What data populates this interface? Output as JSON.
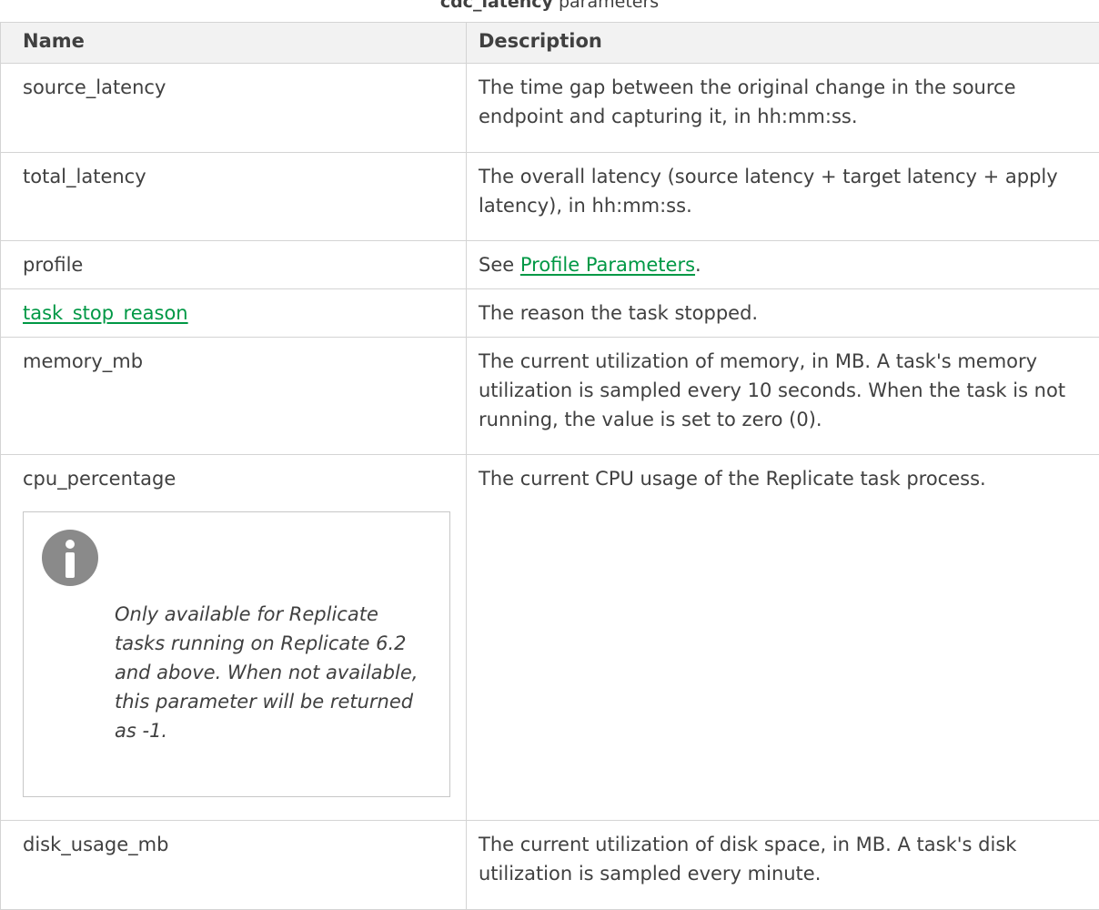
{
  "caption": {
    "bold": "cdc_latency",
    "rest": " parameters"
  },
  "table": {
    "headers": [
      "Name",
      "Description"
    ],
    "rows": [
      {
        "name": "source_latency",
        "description": "The time gap between the original change in the source endpoint and capturing it, in hh:mm:ss."
      },
      {
        "name": "total_latency",
        "description": "The overall latency (source latency + target latency + apply latency), in hh:mm:ss."
      },
      {
        "name": "profile",
        "description_prefix": "See ",
        "description_link": "Profile Parameters",
        "description_suffix": "."
      },
      {
        "name": "task_stop_reason",
        "description": "The reason the task stopped."
      },
      {
        "name": "memory_mb",
        "description": "The current utilization of memory, in MB. A task's memory utilization is sampled every 10 seconds. When the task is not running, the value is set to zero (0)."
      },
      {
        "name": "cpu_percentage",
        "description": "The current CPU usage of the Replicate task process.",
        "note": "Only available for Replicate tasks running on Replicate 6.2 and above. When not available, this parameter will be returned as -1.",
        "note_icon": "info-icon"
      },
      {
        "name": "disk_usage_mb",
        "description": "The current utilization of disk space, in MB. A task's disk utilization is sampled every minute."
      }
    ]
  },
  "colors": {
    "link": "#009845",
    "text": "#404040",
    "header_bg": "#f2f2f2",
    "border": "#d4d4d4",
    "icon": "#8a8a8a"
  }
}
